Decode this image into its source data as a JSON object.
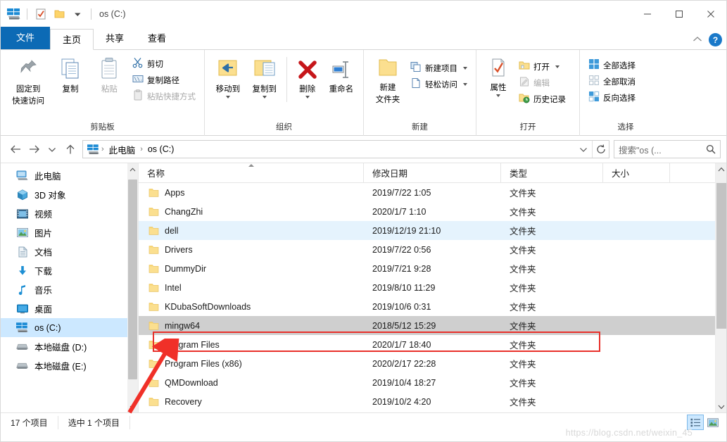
{
  "window": {
    "title": "os (C:)",
    "quick_access": [
      "explorer-icon",
      "properties-checkbox-icon",
      "new-folder-icon",
      "customize-dropdown"
    ],
    "controls": {
      "minimize": "—",
      "maximize": "□",
      "close": "✕"
    }
  },
  "tabs": [
    {
      "label": "文件",
      "state": "file"
    },
    {
      "label": "主页",
      "state": "active"
    },
    {
      "label": "共享",
      "state": "normal"
    },
    {
      "label": "查看",
      "state": "normal"
    }
  ],
  "tab_right": {
    "collapse": "∧",
    "help": "?"
  },
  "ribbon": {
    "groups": [
      {
        "label": "剪贴板",
        "big": [
          {
            "label1": "固定到",
            "label2": "快速访问",
            "icon": "pin-icon",
            "disabled": false
          },
          {
            "label1": "复制",
            "label2": "",
            "icon": "copy-icon",
            "disabled": false
          },
          {
            "label1": "粘贴",
            "label2": "",
            "icon": "paste-icon",
            "disabled": true
          }
        ],
        "small": [
          {
            "label": "剪切",
            "icon": "scissors-icon",
            "disabled": false
          },
          {
            "label": "复制路径",
            "icon": "copy-path-icon",
            "disabled": false
          },
          {
            "label": "粘贴快捷方式",
            "icon": "paste-shortcut-icon",
            "disabled": true
          }
        ]
      },
      {
        "label": "组织",
        "big": [
          {
            "label1": "移动到",
            "label2": "",
            "icon": "move-to-icon",
            "dropdown": true
          },
          {
            "label1": "复制到",
            "label2": "",
            "icon": "copy-to-icon",
            "dropdown": true
          },
          {
            "label1": "删除",
            "label2": "",
            "icon": "delete-icon",
            "dropdown": true
          },
          {
            "label1": "重命名",
            "label2": "",
            "icon": "rename-icon",
            "dropdown": false
          }
        ],
        "small": []
      },
      {
        "label": "新建",
        "big": [
          {
            "label1": "新建",
            "label2": "文件夹",
            "icon": "new-folder-icon",
            "dropdown": false
          }
        ],
        "small": [
          {
            "label": "新建项目",
            "icon": "new-item-icon",
            "dropdown": true
          },
          {
            "label": "轻松访问",
            "icon": "easy-access-icon",
            "dropdown": true
          }
        ]
      },
      {
        "label": "打开",
        "big": [
          {
            "label1": "属性",
            "label2": "",
            "icon": "properties-icon",
            "dropdown": true
          }
        ],
        "small": [
          {
            "label": "打开",
            "icon": "open-icon",
            "dropdown": true,
            "disabled": false
          },
          {
            "label": "编辑",
            "icon": "edit-icon",
            "disabled": true
          },
          {
            "label": "历史记录",
            "icon": "history-icon",
            "disabled": false
          }
        ]
      },
      {
        "label": "选择",
        "big": [],
        "small": [
          {
            "label": "全部选择",
            "icon": "select-all-icon",
            "disabled": false
          },
          {
            "label": "全部取消",
            "icon": "select-none-icon",
            "disabled": false
          },
          {
            "label": "反向选择",
            "icon": "invert-selection-icon",
            "disabled": false
          }
        ]
      }
    ]
  },
  "address": {
    "back": "←",
    "forward": "→",
    "recent": "∨",
    "up": "↑",
    "crumbs": [
      "此电脑",
      "os (C:)"
    ],
    "separator": "›",
    "dropdown": "∨",
    "refresh": "↻",
    "search_placeholder": "搜索\"os (...",
    "search_value": ""
  },
  "sidebar": {
    "items": [
      {
        "label": "此电脑",
        "icon": "this-pc-icon",
        "selected": false,
        "indent": 0
      },
      {
        "label": "3D 对象",
        "icon": "3d-objects-icon",
        "selected": false,
        "indent": 1
      },
      {
        "label": "视频",
        "icon": "videos-icon",
        "selected": false,
        "indent": 1
      },
      {
        "label": "图片",
        "icon": "pictures-icon",
        "selected": false,
        "indent": 1
      },
      {
        "label": "文档",
        "icon": "documents-icon",
        "selected": false,
        "indent": 1
      },
      {
        "label": "下载",
        "icon": "downloads-icon",
        "selected": false,
        "indent": 1
      },
      {
        "label": "音乐",
        "icon": "music-icon",
        "selected": false,
        "indent": 1
      },
      {
        "label": "桌面",
        "icon": "desktop-icon",
        "selected": false,
        "indent": 1
      },
      {
        "label": "os (C:)",
        "icon": "os-drive-icon",
        "selected": true,
        "indent": 1
      },
      {
        "label": "本地磁盘 (D:)",
        "icon": "drive-icon",
        "selected": false,
        "indent": 1
      },
      {
        "label": "本地磁盘 (E:)",
        "icon": "drive-icon",
        "selected": false,
        "indent": 1
      }
    ]
  },
  "filelist": {
    "columns": [
      {
        "label": "名称",
        "sorted": "asc"
      },
      {
        "label": "修改日期",
        "sorted": ""
      },
      {
        "label": "类型",
        "sorted": ""
      },
      {
        "label": "大小",
        "sorted": ""
      }
    ],
    "rows": [
      {
        "name": "Apps",
        "date": "2019/7/22 1:05",
        "type": "文件夹",
        "size": "",
        "state": ""
      },
      {
        "name": "ChangZhi",
        "date": "2020/1/7 1:10",
        "type": "文件夹",
        "size": "",
        "state": ""
      },
      {
        "name": "dell",
        "date": "2019/12/19 21:10",
        "type": "文件夹",
        "size": "",
        "state": "hl"
      },
      {
        "name": "Drivers",
        "date": "2019/7/22 0:56",
        "type": "文件夹",
        "size": "",
        "state": ""
      },
      {
        "name": "DummyDir",
        "date": "2019/7/21 9:28",
        "type": "文件夹",
        "size": "",
        "state": ""
      },
      {
        "name": "Intel",
        "date": "2019/8/10 11:29",
        "type": "文件夹",
        "size": "",
        "state": ""
      },
      {
        "name": "KDubaSoftDownloads",
        "date": "2019/10/6 0:31",
        "type": "文件夹",
        "size": "",
        "state": ""
      },
      {
        "name": "mingw64",
        "date": "2018/5/12 15:29",
        "type": "文件夹",
        "size": "",
        "state": "sel"
      },
      {
        "name": "Program Files",
        "date": "2020/1/7 18:40",
        "type": "文件夹",
        "size": "",
        "state": ""
      },
      {
        "name": "Program Files (x86)",
        "date": "2020/2/17 22:28",
        "type": "文件夹",
        "size": "",
        "state": ""
      },
      {
        "name": "QMDownload",
        "date": "2019/10/4 18:27",
        "type": "文件夹",
        "size": "",
        "state": ""
      },
      {
        "name": "Recovery",
        "date": "2019/10/2 4:20",
        "type": "文件夹",
        "size": "",
        "state": ""
      }
    ]
  },
  "statusbar": {
    "item_count": "17 个项目",
    "selected_count": "选中 1 个项目",
    "view_details": "details-view-icon",
    "view_large": "large-icons-view-icon"
  },
  "watermark": "https://blog.csdn.net/weixin_45",
  "annotations": {
    "highlight_color": "#e8302a",
    "arrow_color": "#f03028"
  }
}
